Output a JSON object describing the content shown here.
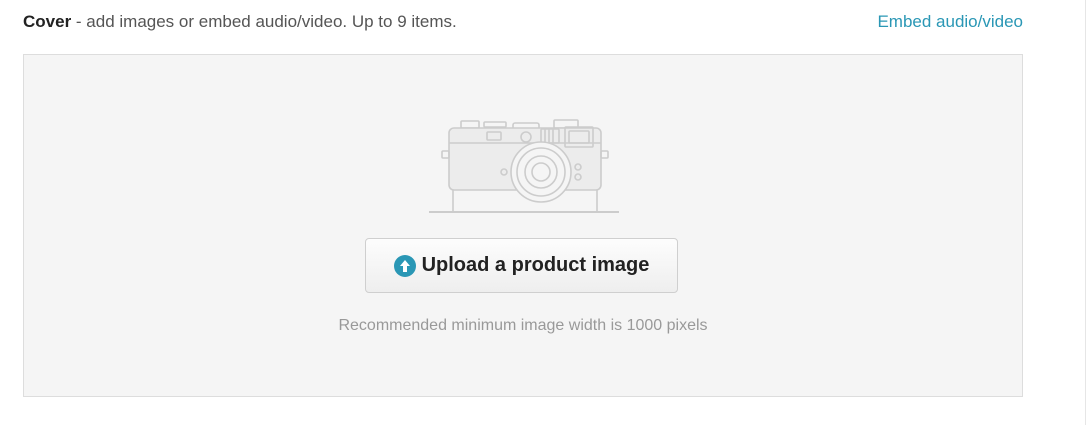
{
  "cover": {
    "title": "Cover",
    "description": " - add images or embed audio/video. Up to 9 items.",
    "embed_link_label": "Embed audio/video"
  },
  "dropzone": {
    "illustration": "camera-icon",
    "upload_button_label": "Upload a product image",
    "upload_button_icon": "upload-arrow-icon",
    "hint": "Recommended minimum image width is 1000 pixels"
  },
  "colors": {
    "accent": "#2a97b5",
    "dropzone_bg": "#f5f5f5"
  }
}
